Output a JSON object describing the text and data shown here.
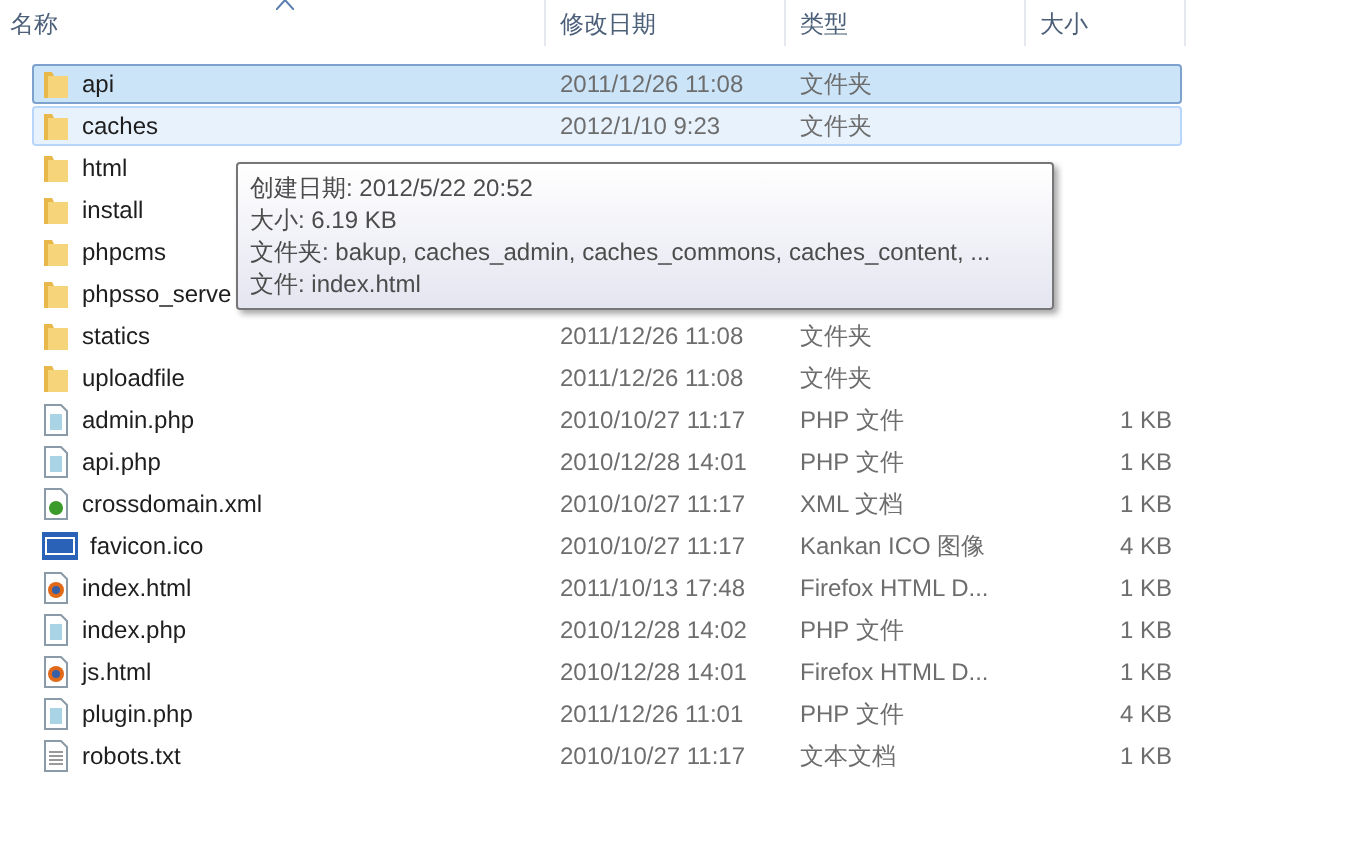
{
  "columns": [
    "名称",
    "修改日期",
    "类型",
    "大小"
  ],
  "rows": [
    {
      "name": "api",
      "kind": "folder",
      "date": "2011/12/26 11:08",
      "type": "文件夹",
      "selected": true,
      "hovered": false
    },
    {
      "name": "caches",
      "kind": "folder",
      "date": "2012/1/10 9:23",
      "type": "文件夹",
      "selected": false,
      "hovered": true
    },
    {
      "name": "html",
      "kind": "folder",
      "selected": false,
      "hovered": false
    },
    {
      "name": "install",
      "kind": "folder",
      "selected": false,
      "hovered": false
    },
    {
      "name": "phpcms",
      "kind": "folder",
      "selected": false,
      "hovered": false
    },
    {
      "name": "phpsso_serve",
      "kind": "folder",
      "selected": false,
      "hovered": false
    },
    {
      "name": "statics",
      "kind": "folder",
      "date": "2011/12/26 11:08",
      "type": "文件夹",
      "selected": false,
      "hovered": false
    },
    {
      "name": "uploadfile",
      "kind": "folder",
      "date": "2011/12/26 11:08",
      "type": "文件夹",
      "selected": false,
      "hovered": false
    },
    {
      "name": "admin.php",
      "kind": "php",
      "date": "2010/10/27 11:17",
      "type": "PHP 文件",
      "size": "1 KB",
      "selected": false,
      "hovered": false
    },
    {
      "name": "api.php",
      "kind": "php",
      "date": "2010/12/28 14:01",
      "type": "PHP 文件",
      "size": "1 KB",
      "selected": false,
      "hovered": false
    },
    {
      "name": "crossdomain.xml",
      "kind": "xml",
      "date": "2010/10/27 11:17",
      "type": "XML 文档",
      "size": "1 KB",
      "selected": false,
      "hovered": false
    },
    {
      "name": "favicon.ico",
      "kind": "ico",
      "date": "2010/10/27 11:17",
      "type": "Kankan ICO 图像",
      "size": "4 KB",
      "selected": false,
      "hovered": false
    },
    {
      "name": "index.html",
      "kind": "html",
      "date": "2011/10/13 17:48",
      "type": "Firefox HTML D...",
      "size": "1 KB",
      "selected": false,
      "hovered": false
    },
    {
      "name": "index.php",
      "kind": "php",
      "date": "2010/12/28 14:02",
      "type": "PHP 文件",
      "size": "1 KB",
      "selected": false,
      "hovered": false
    },
    {
      "name": "js.html",
      "kind": "html",
      "date": "2010/12/28 14:01",
      "type": "Firefox HTML D...",
      "size": "1 KB",
      "selected": false,
      "hovered": false
    },
    {
      "name": "plugin.php",
      "kind": "php",
      "date": "2011/12/26 11:01",
      "type": "PHP 文件",
      "size": "4 KB",
      "selected": false,
      "hovered": false
    },
    {
      "name": "robots.txt",
      "kind": "txt",
      "date": "2010/10/27 11:17",
      "type": "文本文档",
      "size": "1 KB",
      "selected": false,
      "hovered": false
    }
  ],
  "tooltip": [
    "创建日期: 2012/5/22 20:52",
    "大小: 6.19 KB",
    "文件夹: bakup, caches_admin, caches_commons, caches_content, ...",
    "文件: index.html"
  ]
}
